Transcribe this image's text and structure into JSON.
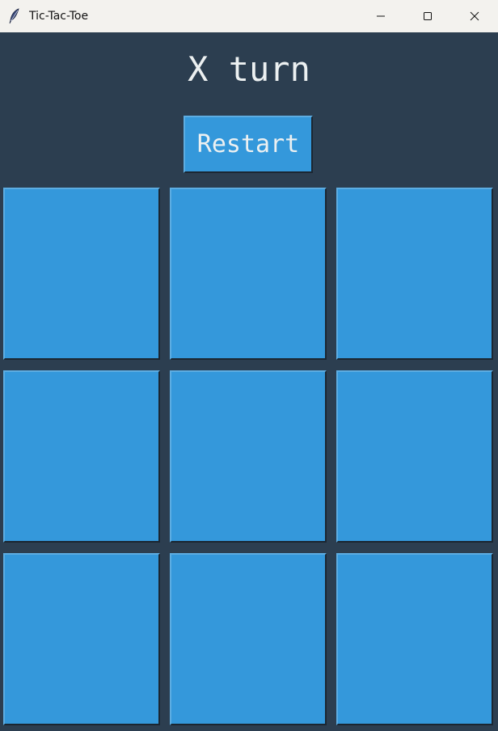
{
  "window": {
    "title": "Tic-Tac-Toe",
    "icon": "feather-icon"
  },
  "game": {
    "status": "X turn",
    "restart_label": "Restart",
    "board": [
      "",
      "",
      "",
      "",
      "",
      "",
      "",
      "",
      ""
    ]
  },
  "colors": {
    "background": "#2c3e50",
    "tile": "#3498db",
    "text": "#ecf0f1"
  }
}
